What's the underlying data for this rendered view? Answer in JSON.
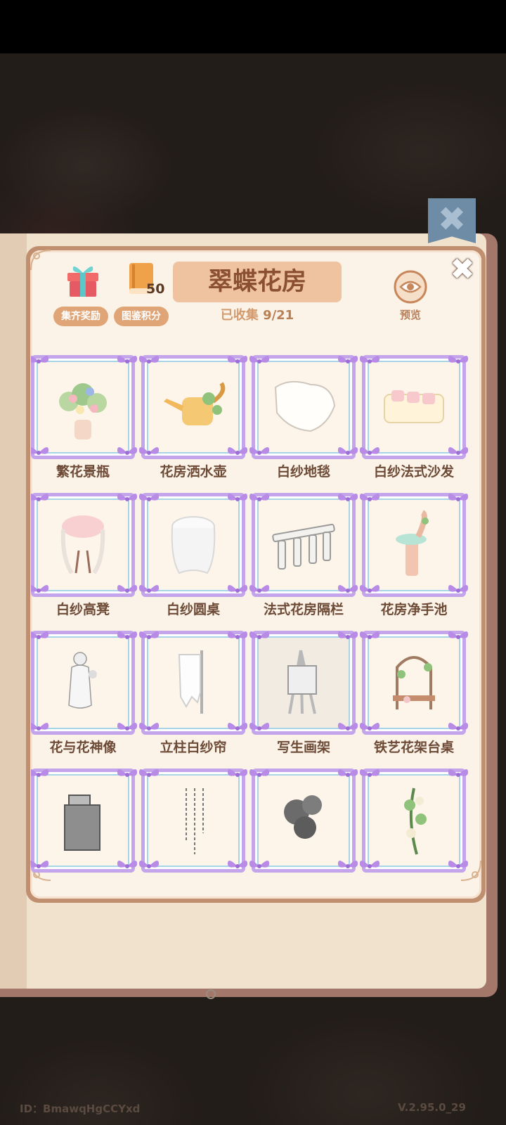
{
  "header": {
    "title": "翠蝶花房",
    "collected_label": "已收集",
    "collected_count": "9/21",
    "reward_button": "集齐奖励",
    "points_button": "图鉴积分",
    "points_value": "50",
    "preview_label": "预览",
    "close_glyph": "✖",
    "ribbon_glyph": "✖"
  },
  "items": [
    {
      "label": "繁花景瓶",
      "icon": "flower-vase-icon"
    },
    {
      "label": "花房洒水壶",
      "icon": "watering-can-icon"
    },
    {
      "label": "白纱地毯",
      "icon": "white-rug-icon"
    },
    {
      "label": "白纱法式沙发",
      "icon": "white-sofa-icon"
    },
    {
      "label": "白纱高凳",
      "icon": "tall-stool-icon"
    },
    {
      "label": "白纱圆桌",
      "icon": "round-table-icon"
    },
    {
      "label": "法式花房隔栏",
      "icon": "railing-icon"
    },
    {
      "label": "花房净手池",
      "icon": "washbasin-icon"
    },
    {
      "label": "花与花神像",
      "icon": "goddess-statue-icon"
    },
    {
      "label": "立柱白纱帘",
      "icon": "curtain-post-icon"
    },
    {
      "label": "写生画架",
      "icon": "easel-icon"
    },
    {
      "label": "铁艺花架台桌",
      "icon": "iron-flower-shelf-icon"
    },
    {
      "label": "",
      "icon": "iron-side-table-icon"
    },
    {
      "label": "",
      "icon": "hanging-beads-icon"
    },
    {
      "label": "",
      "icon": "dark-vine-icon"
    },
    {
      "label": "",
      "icon": "flower-vine-icon"
    }
  ],
  "footer": {
    "id_text": "ID：BmawqHgCCYxd",
    "version": "V.2.95.0_29"
  },
  "colors": {
    "panel_border": "#c08f70",
    "title_bg": "#efc39f",
    "pill_bg": "#e0a576",
    "frame_purple": "#c4a4ea"
  }
}
